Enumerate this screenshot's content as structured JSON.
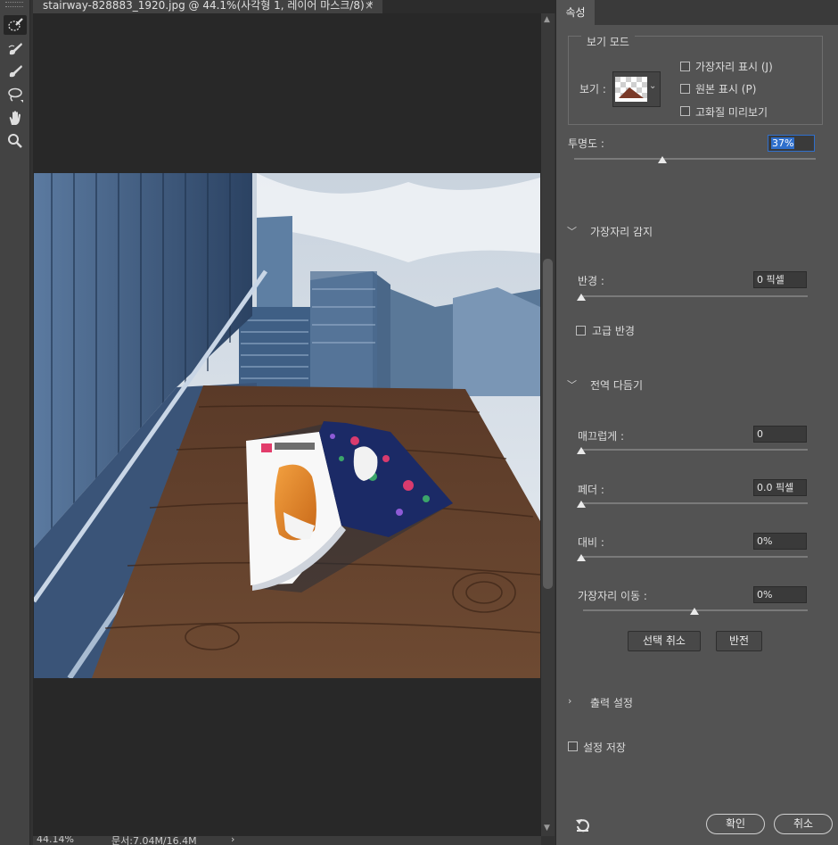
{
  "document": {
    "tab_title": "stairway-828883_1920.jpg @ 44.1%(사각형 1, 레이어 마스크/8) *",
    "close_symbol": "×",
    "status_zoom": "44.14%",
    "status_doc": "문서:7.04M/16.4M",
    "status_arrow": "›"
  },
  "tools": [
    {
      "icon": "quick-selection-icon"
    },
    {
      "icon": "refine-edge-brush-icon"
    },
    {
      "icon": "brush-icon"
    },
    {
      "icon": "lasso-icon"
    },
    {
      "icon": "hand-icon"
    },
    {
      "icon": "zoom-icon"
    }
  ],
  "panel": {
    "tab": "속성",
    "view_mode": {
      "legend": "보기 모드",
      "view_label": "보기 :",
      "options": [
        "가장자리 표시 (J)",
        "원본 표시 (P)",
        "고화질 미리보기"
      ]
    },
    "opacity": {
      "label": "투명도 :",
      "value": "37%",
      "level": 0.37
    },
    "edge_detection": {
      "header": "가장자리 감지",
      "radius_label": "반경 :",
      "radius_value": "0 픽셀",
      "smart_radius": "고급 반경"
    },
    "global_refine": {
      "header": "전역 다듬기",
      "smooth_label": "매끄럽게 :",
      "smooth_value": "0",
      "feather_label": "페더 :",
      "feather_value": "0.0 픽셀",
      "contrast_label": "대비 :",
      "contrast_value": "0%",
      "shift_label": "가장자리 이동 :",
      "shift_value": "0%",
      "shift_level": 0.5,
      "clear_selection": "선택 취소",
      "invert": "반전"
    },
    "output": {
      "header": "출력 설정"
    },
    "remember": "설정 저장",
    "ok": "확인",
    "cancel": "취소"
  },
  "colors": {
    "panel_bg": "#535353",
    "canvas_bg": "#282828",
    "highlight": "#2f6fcc"
  }
}
